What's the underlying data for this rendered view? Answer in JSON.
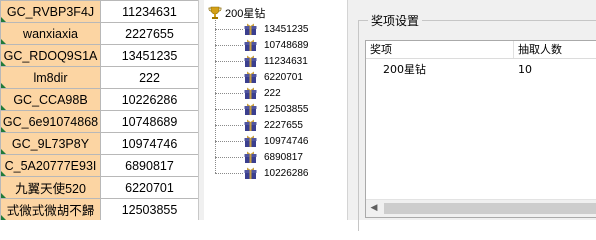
{
  "sheet": {
    "rows": [
      [
        "GC_RVBP3F4J",
        "11234631"
      ],
      [
        "wanxiaxia",
        "2227655"
      ],
      [
        "GC_RDOQ9S1A",
        "13451235"
      ],
      [
        "lm8dir",
        "222"
      ],
      [
        "GC_CCA98B",
        "10226286"
      ],
      [
        "GC_6e91074868",
        "10748689"
      ],
      [
        "GC_9L73P8Y",
        "10974746"
      ],
      [
        "C_5A20777E93I",
        "6890817"
      ],
      [
        "九翼天使520",
        "6220701"
      ],
      [
        "式微式微胡不歸",
        "12503855"
      ]
    ]
  },
  "tree": {
    "root_label": "200星钻",
    "root_icon": "trophy-icon",
    "node_icon": "gift-box-icon",
    "items": [
      "13451235",
      "10748689",
      "11234631",
      "6220701",
      "222",
      "12503855",
      "2227655",
      "10974746",
      "6890817",
      "10226286"
    ]
  },
  "panel": {
    "group_title": "奖项设置",
    "columns": [
      "奖项",
      "抽取人数"
    ],
    "rows": [
      {
        "prize": "200星钻",
        "count": "10"
      }
    ]
  },
  "colors": {
    "highlight": "#fcd5a3",
    "trophy": "#d4a017",
    "gift": "#3b3f8f"
  }
}
